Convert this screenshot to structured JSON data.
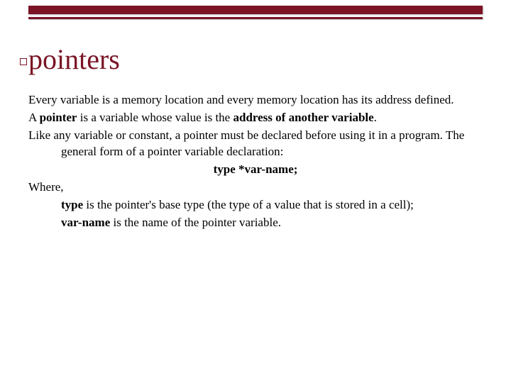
{
  "title": "pointers",
  "body": {
    "p1": "Every variable is a memory location and every memory location has its address defined.",
    "p2_a": "A ",
    "p2_b": "pointer",
    "p2_c": " is a variable whose value is the ",
    "p2_d": "address of another variable",
    "p2_e": ".",
    "p3": "Like any variable or constant, a pointer must be declared before using it in a program. The general form of a pointer variable declaration:",
    "decl": "type *var-name;",
    "where": "Where,",
    "type_a": "type",
    "type_b": " is the pointer's base type (the type of a value that is stored in a cell);",
    "var_a": "var-name",
    "var_b": " is the name of the pointer variable."
  }
}
